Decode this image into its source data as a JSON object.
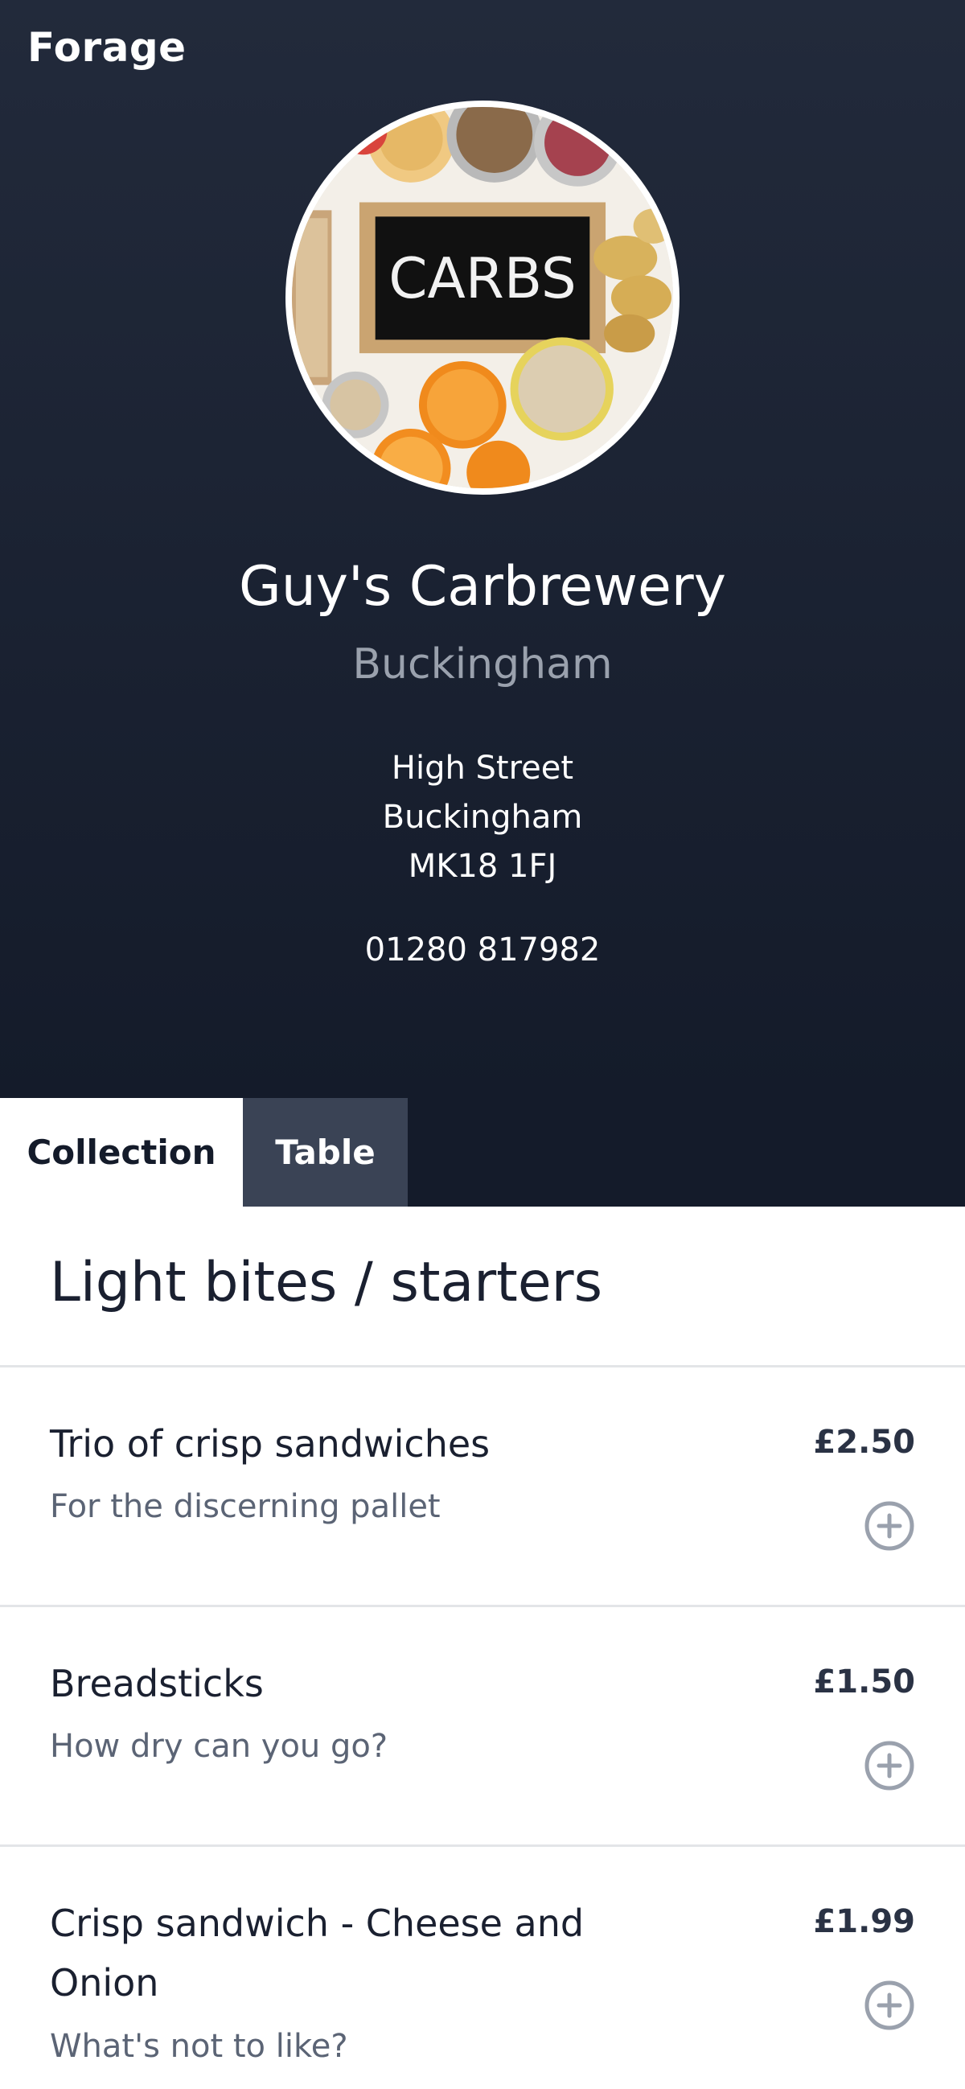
{
  "app": {
    "brand": "Forage"
  },
  "venue": {
    "name": "Guy's Carbrewery",
    "town": "Buckingham",
    "address": [
      "High Street",
      "Buckingham",
      "MK18 1FJ"
    ],
    "phone": "01280 817982",
    "image_text": "CARBS"
  },
  "tabs": [
    {
      "label": "Collection",
      "active": true
    },
    {
      "label": "Table",
      "active": false
    }
  ],
  "menu": {
    "section_title": "Light bites / starters",
    "items": [
      {
        "name": "Trio of crisp sandwiches",
        "description": "For the discerning pallet",
        "price": "£2.50",
        "add_icon": "plus-circle-icon"
      },
      {
        "name": "Breadsticks",
        "description": "How dry can you go?",
        "price": "£1.50",
        "add_icon": "plus-circle-icon"
      },
      {
        "name": "Crisp sandwich - Cheese and Onion",
        "description": "What's not to like?",
        "price": "£1.99",
        "add_icon": "plus-circle-icon"
      }
    ]
  },
  "colors": {
    "header_bg": "#1a2232",
    "tab_active_bg": "#ffffff",
    "tab_inactive_bg": "#3a4355",
    "text_dark": "#1a2030",
    "text_muted": "#5b6475",
    "icon_gray": "#9aa1ad"
  }
}
